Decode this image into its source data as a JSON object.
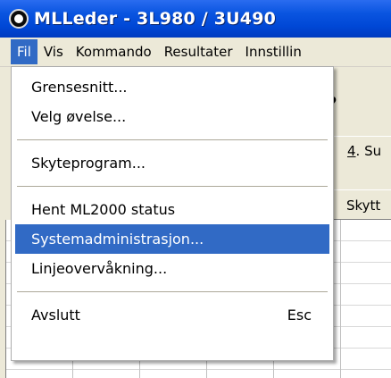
{
  "window": {
    "title": "MLLeder - 3L980 / 3U490"
  },
  "menubar": {
    "items": [
      {
        "label": "Fil",
        "active": true
      },
      {
        "label": "Vis"
      },
      {
        "label": "Kommando"
      },
      {
        "label": "Resultater"
      },
      {
        "label": "Innstillin"
      }
    ]
  },
  "background": {
    "toolbar_glyph": "?",
    "tab_label_number": "4",
    "tab_label_rest": ". Su",
    "column_header": "Skytt"
  },
  "dropdown": {
    "items": [
      {
        "label": "Grensesnitt..."
      },
      {
        "label": "Velg øvelse..."
      },
      {
        "label": "Skyteprogram..."
      },
      {
        "label": "Hent ML2000 status"
      },
      {
        "label": "Systemadministrasjon...",
        "highlighted": true
      },
      {
        "label": "Linjeovervåkning..."
      },
      {
        "label": "Avslutt",
        "shortcut": "Esc"
      }
    ]
  },
  "colors": {
    "titlebar": "#0047d6",
    "highlight": "#316ac5"
  }
}
